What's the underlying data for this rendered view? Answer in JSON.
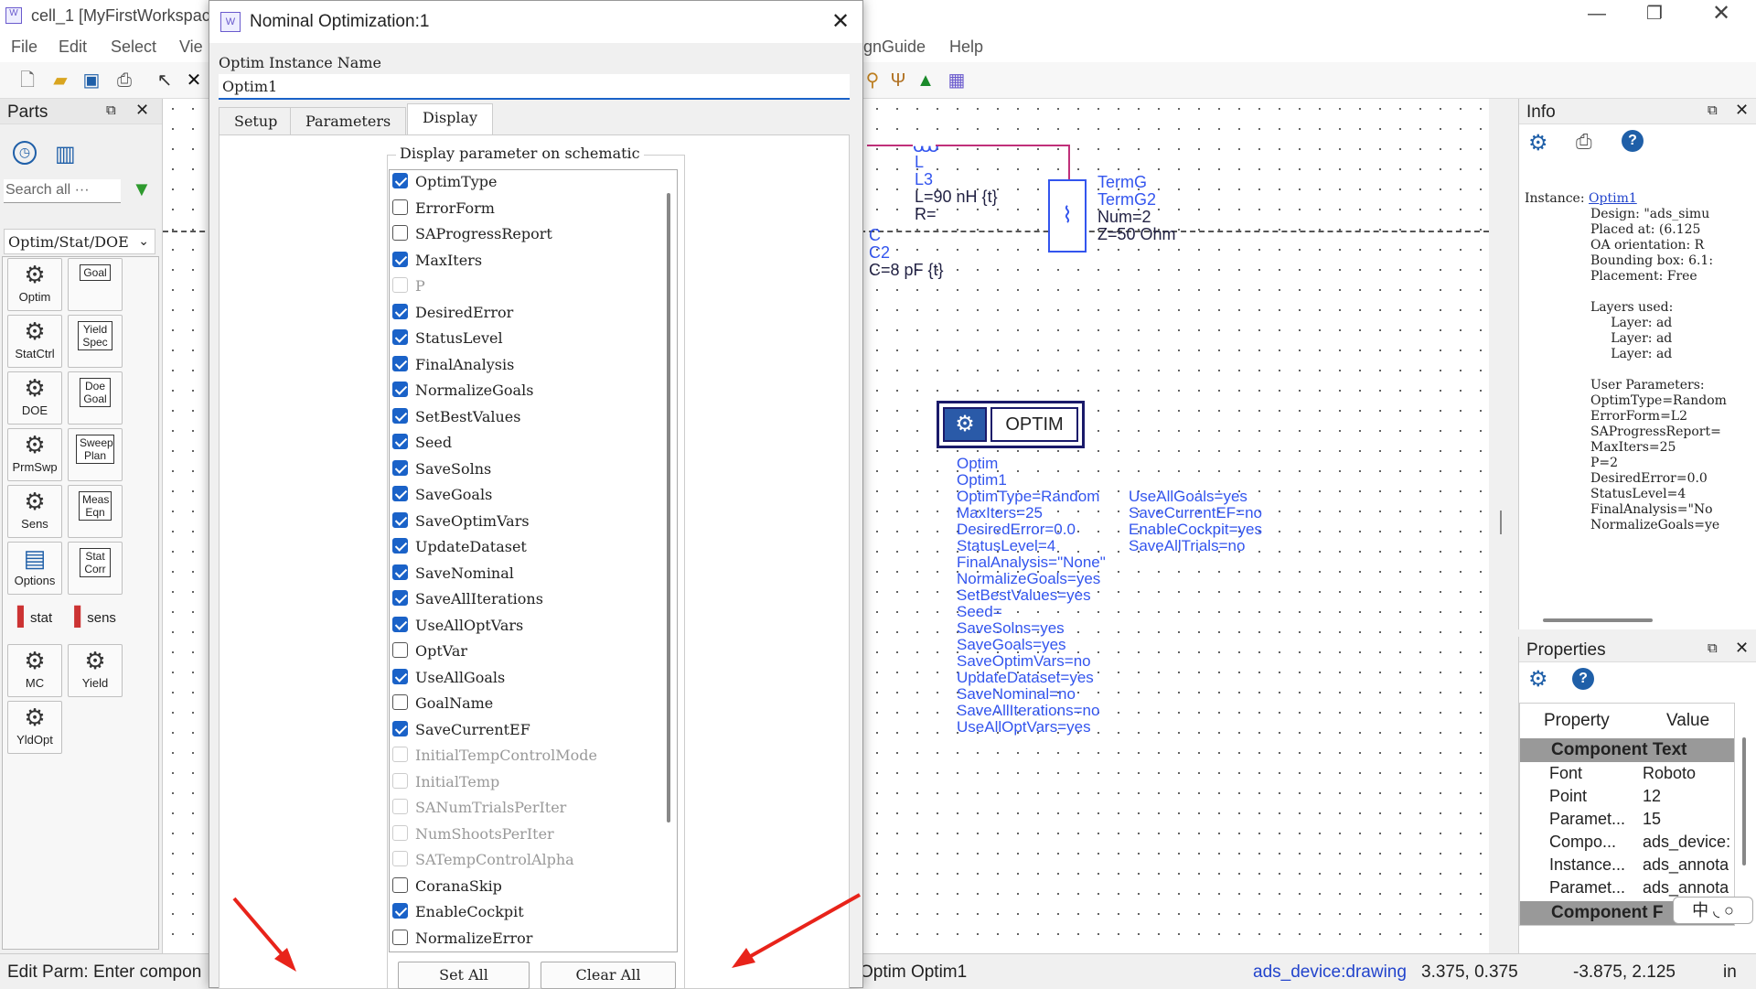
{
  "app": {
    "title": "cell_1 [MyFirstWorkspac",
    "menu": [
      "File",
      "Edit",
      "Select",
      "Vie",
      "gnGuide",
      "Help"
    ]
  },
  "parts": {
    "title": "Parts",
    "search_placeholder": "Search all ···",
    "library": "Optim/Stat/DOE",
    "items": [
      "Optim",
      "Goal",
      "StatCtrl",
      "Yield Spec",
      "DOE",
      "Doe Goal",
      "PrmSwp",
      "Sweep Plan",
      "Sens",
      "Meas Eqn",
      "Options",
      "Stat Corr",
      "stat",
      "sens",
      "MC",
      "Yield",
      "YldOpt"
    ]
  },
  "schematic": {
    "inductor": [
      "L",
      "L3",
      "L=90 nH {t}",
      "R="
    ],
    "capacitor": [
      "C",
      "C2",
      "C=8 pF {t}"
    ],
    "term": [
      "TermG",
      "TermG2",
      "Num=2",
      "Z=50 Ohm"
    ],
    "optim_label": "OPTIM",
    "optim_params_left": [
      "Optim",
      "Optim1",
      "OptimType=Random",
      "MaxIters=25",
      "DesiredError=0.0",
      "StatusLevel=4",
      "FinalAnalysis=\"None\"",
      "NormalizeGoals=yes",
      "SetBestValues=yes",
      "Seed=",
      "SaveSolns=yes",
      "SaveGoals=yes",
      "SaveOptimVars=no",
      "UpdateDataset=yes",
      "SaveNominal=no",
      "SaveAllIterations=no",
      "UseAllOptVars=yes"
    ],
    "optim_params_right": [
      "UseAllGoals=yes",
      "SaveCurrentEF=no",
      "EnableCockpit=yes",
      "SaveAllTrials=no"
    ]
  },
  "info": {
    "title": "Info",
    "instance_label": "Instance:",
    "instance_link": "Optim1",
    "lines": [
      "Design: \"ads_simu",
      "Placed at: (6.125",
      "OA orientation: R",
      "Bounding box: 6.1:",
      "Placement: Free",
      "",
      "Layers used:",
      "     Layer: ad",
      "     Layer: ad",
      "     Layer: ad",
      "",
      "User Parameters:",
      "OptimType=Random",
      "ErrorForm=L2",
      "SAProgressReport=",
      "MaxIters=25",
      "P=2",
      "DesiredError=0.0",
      "StatusLevel=4",
      "FinalAnalysis=\"No",
      "NormalizeGoals=ye"
    ]
  },
  "properties": {
    "title": "Properties",
    "col_property": "Property",
    "col_value": "Value",
    "section1": "Component Text",
    "rows": [
      {
        "k": "Font",
        "v": "Roboto"
      },
      {
        "k": "Point",
        "v": "12"
      },
      {
        "k": "Paramet...",
        "v": "15"
      },
      {
        "k": "Compo...",
        "v": "ads_device:"
      },
      {
        "k": "Instance...",
        "v": "ads_annota"
      },
      {
        "k": "Paramet...",
        "v": "ads_annota"
      }
    ],
    "section2": "Component F",
    "ime": "中 ◟ ○"
  },
  "status": {
    "left": "Edit Parm: Enter compon",
    "mid": "Optim Optim1",
    "layer": "ads_device:drawing",
    "xy1": "3.375, 0.375",
    "xy2": "-3.875, 2.125",
    "unit": "in"
  },
  "dialog": {
    "title": "Nominal Optimization:1",
    "instance_label": "Optim Instance Name",
    "instance_value": "Optim1",
    "tabs": [
      "Setup",
      "Parameters",
      "Display"
    ],
    "group_label": "Display parameter on schematic",
    "params": [
      {
        "name": "OptimType",
        "state": "on"
      },
      {
        "name": "ErrorForm",
        "state": "off"
      },
      {
        "name": "SAProgressReport",
        "state": "off"
      },
      {
        "name": "MaxIters",
        "state": "on"
      },
      {
        "name": "P",
        "state": "dis"
      },
      {
        "name": "DesiredError",
        "state": "on"
      },
      {
        "name": "StatusLevel",
        "state": "on"
      },
      {
        "name": "FinalAnalysis",
        "state": "on"
      },
      {
        "name": "NormalizeGoals",
        "state": "on"
      },
      {
        "name": "SetBestValues",
        "state": "on"
      },
      {
        "name": "Seed",
        "state": "on"
      },
      {
        "name": "SaveSolns",
        "state": "on"
      },
      {
        "name": "SaveGoals",
        "state": "on"
      },
      {
        "name": "SaveOptimVars",
        "state": "on"
      },
      {
        "name": "UpdateDataset",
        "state": "on"
      },
      {
        "name": "SaveNominal",
        "state": "on"
      },
      {
        "name": "SaveAllIterations",
        "state": "on"
      },
      {
        "name": "UseAllOptVars",
        "state": "on"
      },
      {
        "name": "OptVar",
        "state": "off"
      },
      {
        "name": "UseAllGoals",
        "state": "on"
      },
      {
        "name": "GoalName",
        "state": "off"
      },
      {
        "name": "SaveCurrentEF",
        "state": "on"
      },
      {
        "name": "InitialTempControlMode",
        "state": "dis"
      },
      {
        "name": "InitialTemp",
        "state": "dis"
      },
      {
        "name": "SANumTrialsPerIter",
        "state": "dis"
      },
      {
        "name": "NumShootsPerIter",
        "state": "dis"
      },
      {
        "name": "SATempControlAlpha",
        "state": "dis"
      },
      {
        "name": "CoranaSkip",
        "state": "off"
      },
      {
        "name": "EnableCockpit",
        "state": "on"
      },
      {
        "name": "NormalizeError",
        "state": "off"
      }
    ],
    "set_all": "Set All",
    "clear_all": "Clear All"
  },
  "colors": {
    "accent": "#1a62c8",
    "schematic_blue": "#3355ee",
    "arrow_red": "#e8231a",
    "wire": "#c0307a"
  }
}
